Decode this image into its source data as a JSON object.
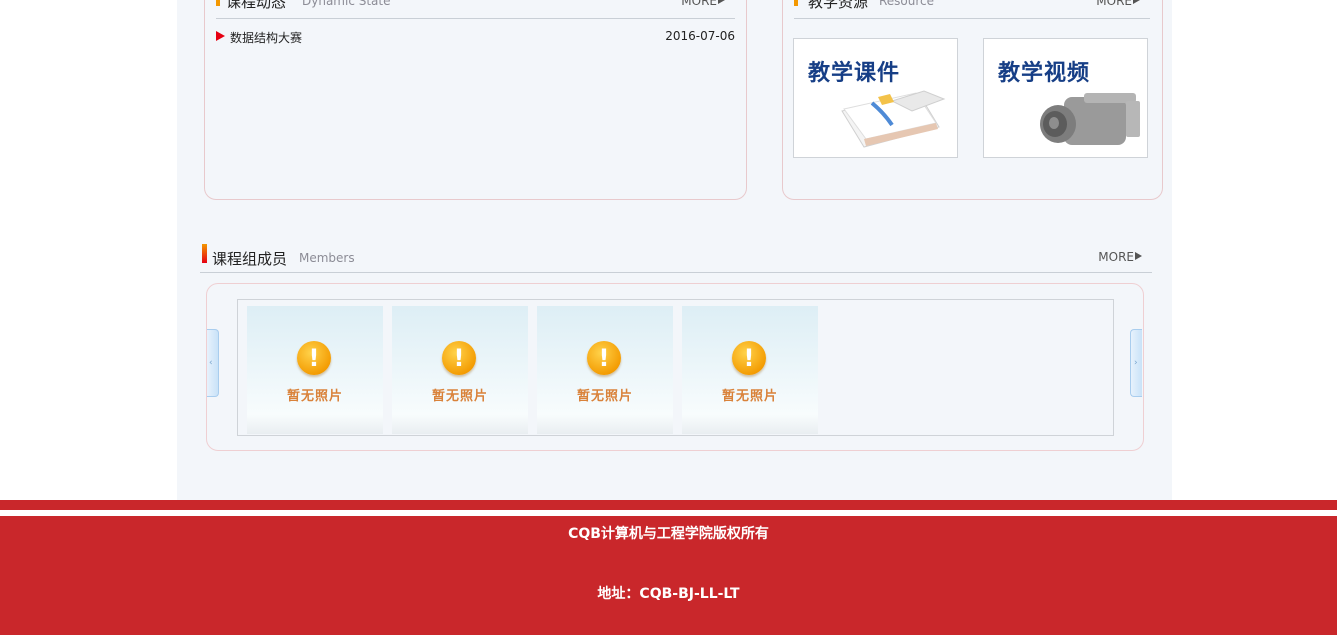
{
  "news": {
    "title": "课程动态",
    "subtitle": "Dynamic State",
    "more": "MORE",
    "items": [
      {
        "text": "数据结构大赛",
        "date": "2016-07-06"
      }
    ]
  },
  "resources": {
    "title": "教学资源",
    "subtitle": "Resource",
    "more": "MORE",
    "cards": [
      {
        "label": "教学课件"
      },
      {
        "label": "教学视频"
      }
    ]
  },
  "members": {
    "title": "课程组成员",
    "subtitle": "Members",
    "more": "MORE",
    "photos": [
      {
        "placeholder": "暂无照片"
      },
      {
        "placeholder": "暂无照片"
      },
      {
        "placeholder": "暂无照片"
      },
      {
        "placeholder": "暂无照片"
      }
    ]
  },
  "footer": {
    "copyright": "CQB计算机与工程学院版权所有",
    "address": "地址：CQB-BJ-LL-LT"
  },
  "colors": {
    "accent_orange": "#f39800",
    "footer_red": "#c9272b",
    "link_red": "#e60012",
    "resource_label_blue": "#163e86"
  }
}
